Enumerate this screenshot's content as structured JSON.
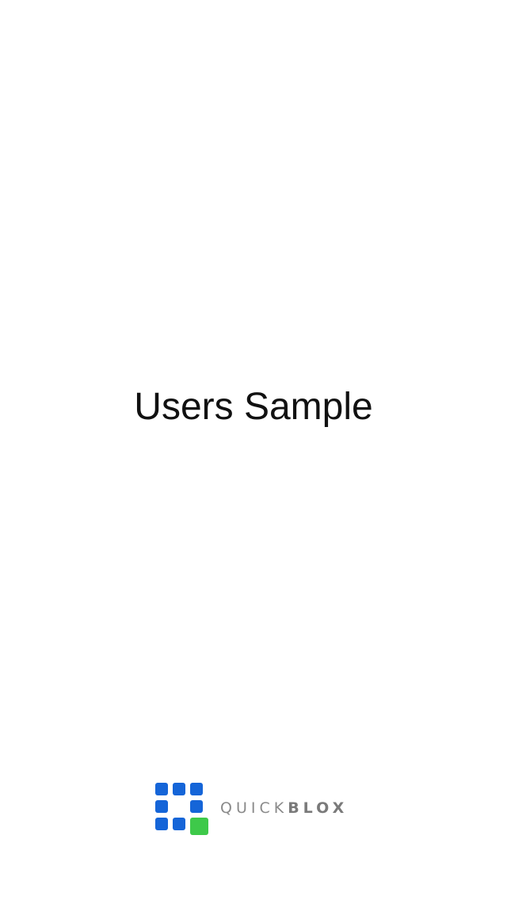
{
  "splash": {
    "title": "Users Sample"
  },
  "logo": {
    "icon": "quickblox-logo-icon",
    "text_light": "QUICK",
    "text_bold": "BLOX",
    "colors": {
      "blue": "#1565d8",
      "green": "#3ec94a",
      "text": "#8a8a8a"
    }
  }
}
